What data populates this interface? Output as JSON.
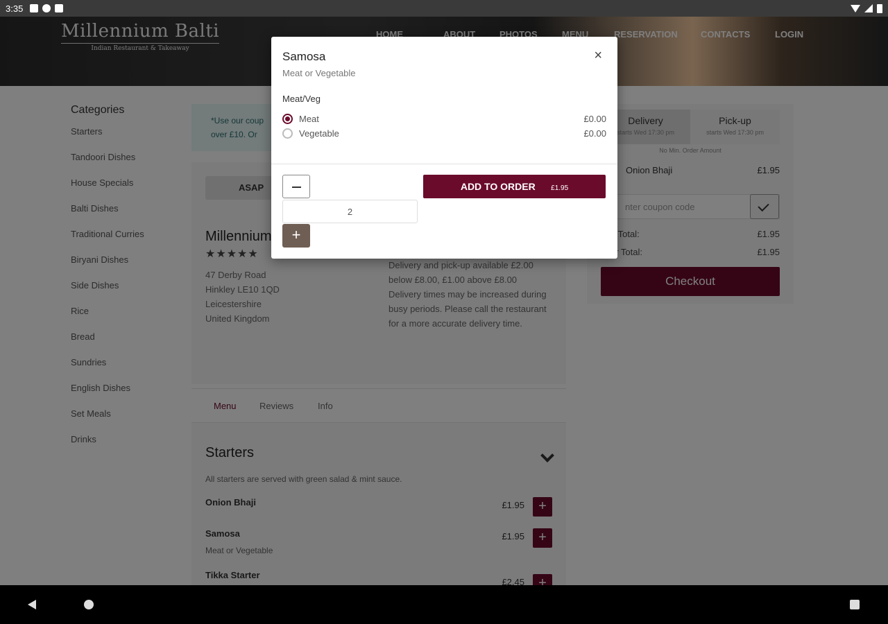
{
  "status": {
    "time": "3:35"
  },
  "brand": {
    "name": "Millennium Balti",
    "tagline": "Indian Restaurant & Takeaway"
  },
  "nav": [
    "HOME",
    "ABOUT",
    "PHOTOS",
    "MENU",
    "RESERVATION",
    "CONTACTS",
    "LOGIN"
  ],
  "categories": {
    "title": "Categories",
    "items": [
      "Starters",
      "Tandoori Dishes",
      "House Specials",
      "Balti Dishes",
      "Traditional Curries",
      "Biryani Dishes",
      "Side Dishes",
      "Rice",
      "Bread",
      "Sundries",
      "English Dishes",
      "Set Meals",
      "Drinks"
    ]
  },
  "promo": {
    "line1": "*Use our coup",
    "line2": "over £10. Or"
  },
  "restaurant": {
    "time_select": "ASAP",
    "name": "Millennium",
    "stars": "★★★★★",
    "address": [
      "47 Derby Road",
      "Hinkley LE10 1QD",
      "Leicestershire",
      "United Kingdom"
    ],
    "delivery_info": "Delivery and pick-up available £2.00 below £8.00, £1.00 above £8.00 Delivery times may be increased during busy periods. Please call the restaurant for a more accurate delivery time."
  },
  "tabs": [
    "Menu",
    "Reviews",
    "Info"
  ],
  "menu": {
    "section_title": "Starters",
    "section_desc": "All starters are served with green salad & mint sauce.",
    "items": [
      {
        "name": "Onion Bhaji",
        "desc": "",
        "price": "£1.95"
      },
      {
        "name": "Samosa",
        "desc": "Meat or Vegetable",
        "price": "£1.95"
      },
      {
        "name": "Tikka Starter",
        "desc": "",
        "price": "£2.45"
      }
    ]
  },
  "order": {
    "tabs": [
      {
        "label": "Delivery",
        "sub": "starts Wed 17:30 pm"
      },
      {
        "label": "Pick-up",
        "sub": "starts Wed 17:30 pm"
      }
    ],
    "min_order": "No Min. Order Amount",
    "line_item": {
      "name": "Onion Bhaji",
      "price": "£1.95"
    },
    "coupon_placeholder": "nter coupon code",
    "subtotal": {
      "label": "b Total:",
      "value": "£1.95"
    },
    "total": {
      "label": "er Total:",
      "value": "£1.95"
    },
    "checkout": "Checkout"
  },
  "modal": {
    "title": "Samosa",
    "subtitle": "Meat or Vegetable",
    "close": "×",
    "group_label": "Meat/Veg",
    "options": [
      {
        "label": "Meat",
        "price": "£0.00",
        "selected": true
      },
      {
        "label": "Vegetable",
        "price": "£0.00",
        "selected": false
      }
    ],
    "quantity": "2",
    "plus": "+",
    "add_label": "ADD TO ORDER",
    "add_price": "£1.95"
  },
  "colors": {
    "accent": "#6b0b2c",
    "plus_button": "#6f5e54"
  }
}
